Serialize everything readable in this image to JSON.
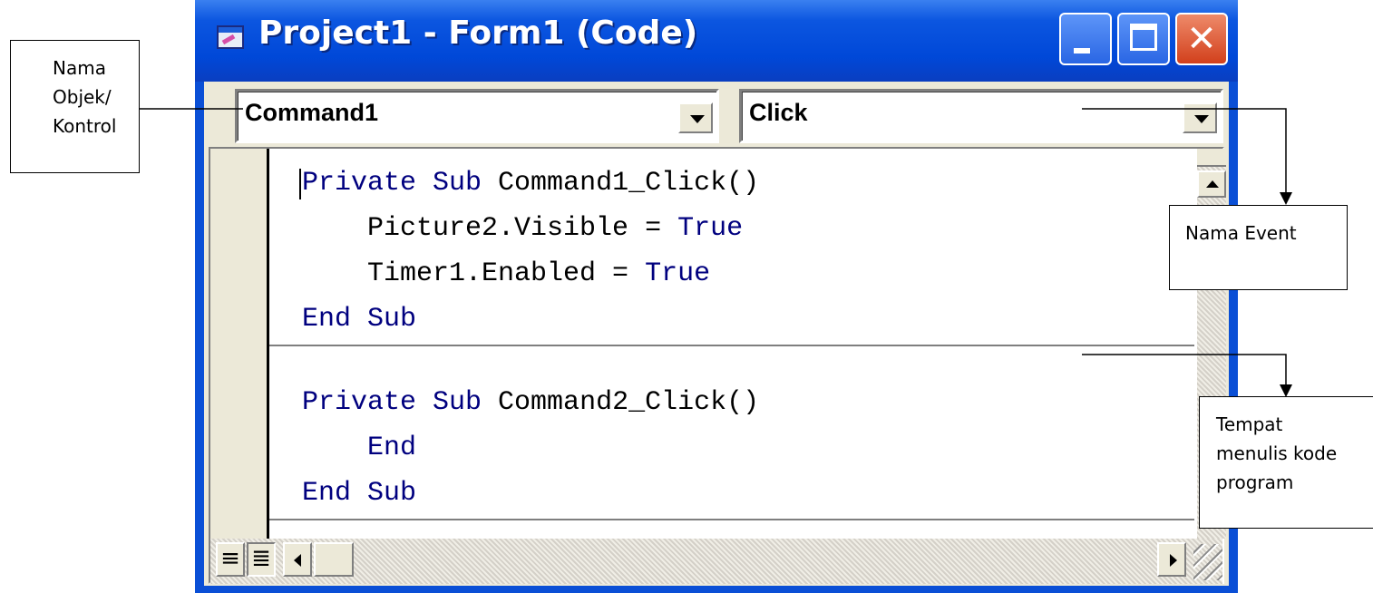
{
  "window": {
    "title": "Project1 - Form1 (Code)",
    "close_glyph": "✕"
  },
  "object_combo": {
    "value": "Command1"
  },
  "event_combo": {
    "value": "Click"
  },
  "code": {
    "procedures": [
      {
        "lines": [
          {
            "kw": "Private Sub",
            "text": " Command1_Click()"
          },
          {
            "indent": "    ",
            "text": "Picture2.Visible = ",
            "kw_after": "True"
          },
          {
            "indent": "    ",
            "text": "Timer1.Enabled = ",
            "kw_after": "True"
          },
          {
            "kw": "End Sub",
            "text": ""
          }
        ]
      },
      {
        "lines": [
          {
            "kw": "Private Sub",
            "text": " Command2_Click()"
          },
          {
            "indent": "    ",
            "kw": "End",
            "text": ""
          },
          {
            "kw": "End Sub",
            "text": ""
          }
        ]
      }
    ],
    "keyword_color": "#00007f"
  },
  "view_buttons": {
    "procedure_view": "≡",
    "full_module_view": "≣"
  },
  "annotations": {
    "object": {
      "lines": [
        "Nama",
        "Objek/",
        "Kontrol"
      ]
    },
    "event": {
      "lines": [
        "Nama Event"
      ]
    },
    "code_area": {
      "lines": [
        "Tempat",
        "menulis kode",
        "program"
      ]
    }
  },
  "colors": {
    "titlebar": "#0048d8",
    "client": "#ece9d8",
    "close_button": "#d2401c"
  }
}
